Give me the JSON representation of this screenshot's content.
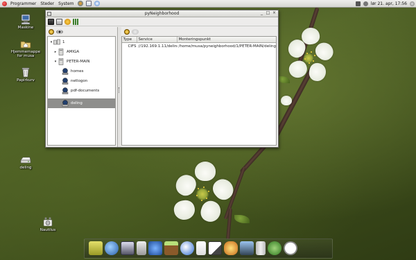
{
  "top_panel": {
    "menus": [
      "Programmer",
      "Steder",
      "System"
    ],
    "clock": "lør 21. apr, 17:56"
  },
  "desktop_icons": [
    {
      "label": "Maskine"
    },
    {
      "label": "Hjemmemappe for musa"
    },
    {
      "label": "Papirkurv"
    },
    {
      "label": "deling"
    },
    {
      "label": "Nautilus"
    }
  ],
  "window": {
    "title": "pyNeighborhood",
    "tree": [
      {
        "label": "1",
        "expander": ""
      },
      {
        "label": "AMIGA",
        "expander": "▸"
      },
      {
        "label": "PETER-MAIN",
        "expander": "▾"
      },
      {
        "label": "homes",
        "expander": ""
      },
      {
        "label": "netlogon",
        "expander": ""
      },
      {
        "label": "pdf-documents",
        "expander": ""
      },
      {
        "label": "deling",
        "expander": "",
        "selected": true
      }
    ],
    "table": {
      "columns": [
        "Type",
        "Service",
        "Monteringspunkt"
      ],
      "rows": [
        {
          "type": "CIFS",
          "service": "//192.169.1.11/deling",
          "mount": "/home/musa/pyneighborhood/1/PETER-MAIN/deling"
        }
      ]
    }
  },
  "colors": {
    "selection": "#8e8e8c",
    "panel": "#e3e3e0",
    "desktop": "#46571f"
  }
}
